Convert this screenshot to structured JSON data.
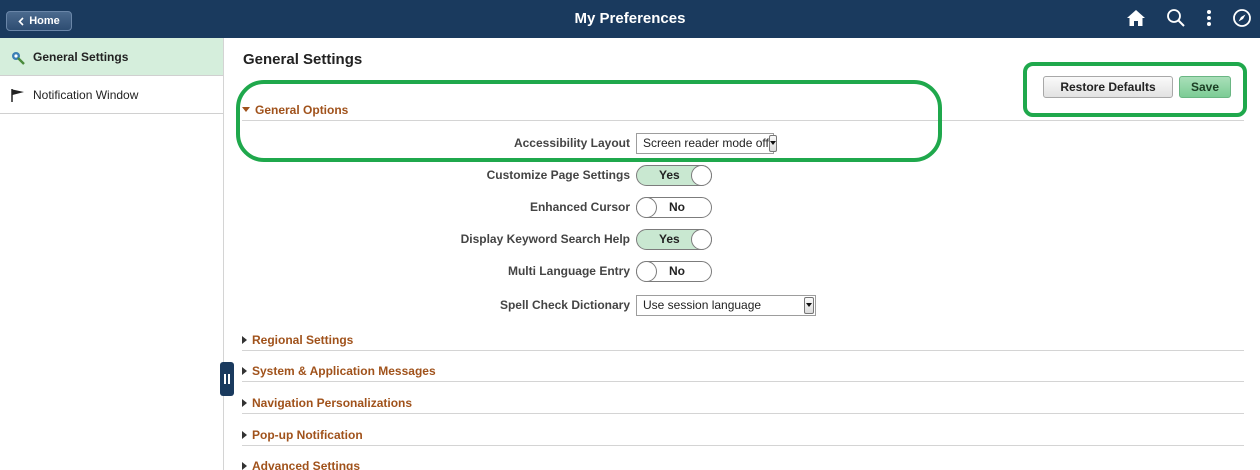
{
  "topbar": {
    "home_label": "Home",
    "title": "My Preferences",
    "icons": [
      "home-icon",
      "search-icon",
      "kebab-menu-icon",
      "compass-icon"
    ]
  },
  "sidebar": {
    "items": [
      {
        "label": "General Settings",
        "icon": "wrench-gear-icon",
        "active": true
      },
      {
        "label": "Notification Window",
        "icon": "flag-icon",
        "active": false
      }
    ]
  },
  "main": {
    "heading": "General Settings",
    "restore_label": "Restore Defaults",
    "save_label": "Save",
    "general_options": {
      "title": "General Options",
      "accessibility_label": "Accessibility Layout",
      "accessibility_value": "Screen reader mode off",
      "customize_label": "Customize Page Settings",
      "customize_value": "Yes",
      "cursor_label": "Enhanced Cursor",
      "cursor_value": "No",
      "keyword_label": "Display Keyword Search Help",
      "keyword_value": "Yes",
      "multilang_label": "Multi Language Entry",
      "multilang_value": "No",
      "spell_label": "Spell Check Dictionary",
      "spell_value": "Use session language"
    },
    "sections": [
      "Regional Settings",
      "System & Application Messages",
      "Navigation Personalizations",
      "Pop-up Notification",
      "Advanced Settings"
    ]
  },
  "colors": {
    "topbar": "#1a3a5e",
    "section_title": "#a0521b",
    "toggle_on": "#c9e8d1",
    "save_button": "#7ccc95",
    "annotation": "#1fa84c"
  }
}
